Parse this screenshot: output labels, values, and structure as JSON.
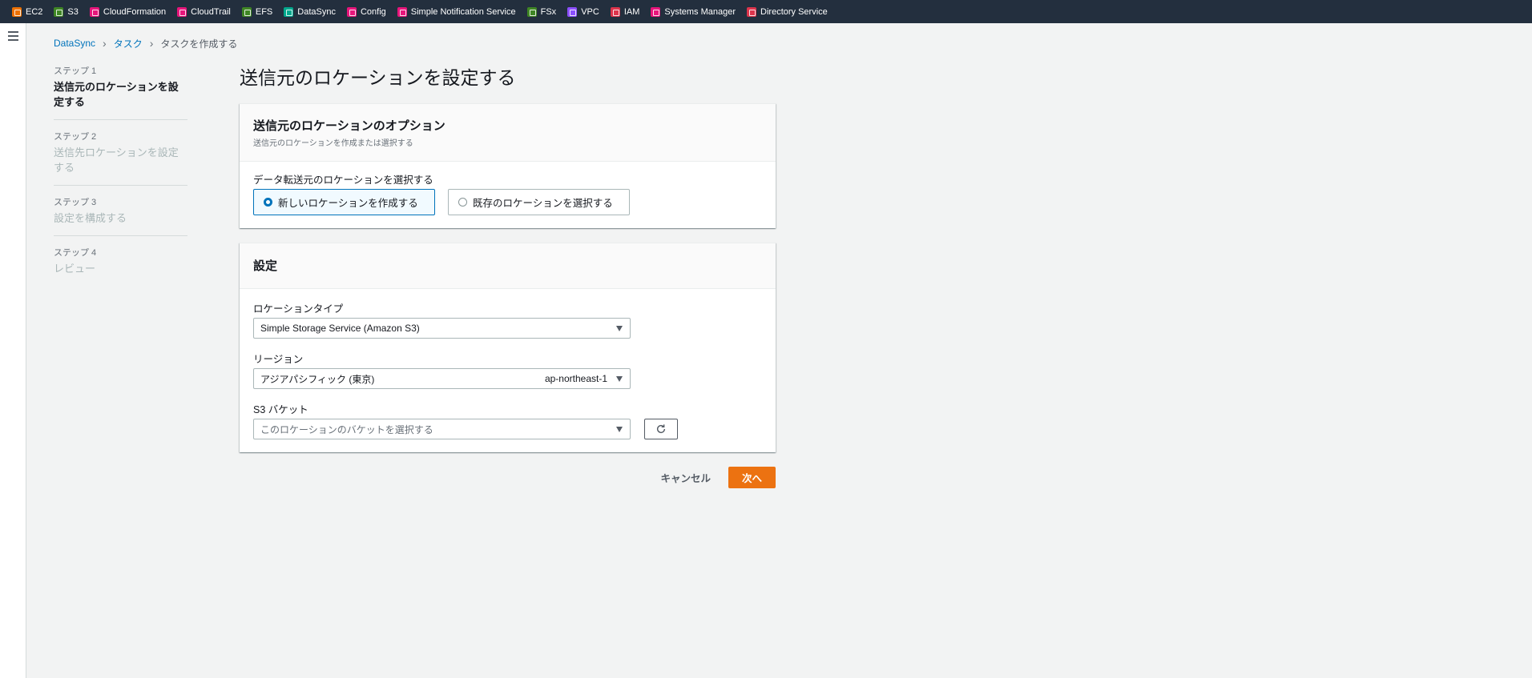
{
  "favorites": [
    {
      "label": "EC2",
      "color": "#ed7100"
    },
    {
      "label": "S3",
      "color": "#3f8624"
    },
    {
      "label": "CloudFormation",
      "color": "#e7157b"
    },
    {
      "label": "CloudTrail",
      "color": "#e7157b"
    },
    {
      "label": "EFS",
      "color": "#3f8624"
    },
    {
      "label": "DataSync",
      "color": "#01a88d"
    },
    {
      "label": "Config",
      "color": "#e7157b"
    },
    {
      "label": "Simple Notification Service",
      "color": "#e7157b"
    },
    {
      "label": "FSx",
      "color": "#3f8624"
    },
    {
      "label": "VPC",
      "color": "#8c4fff"
    },
    {
      "label": "IAM",
      "color": "#dd344c"
    },
    {
      "label": "Systems Manager",
      "color": "#e7157b"
    },
    {
      "label": "Directory Service",
      "color": "#dd344c"
    }
  ],
  "breadcrumb": {
    "items": [
      "DataSync",
      "タスク"
    ],
    "current": "タスクを作成する"
  },
  "steps": [
    {
      "num": "ステップ 1",
      "title": "送信元のロケーションを設定する",
      "active": true
    },
    {
      "num": "ステップ 2",
      "title": "送信先ロケーションを設定する",
      "active": false
    },
    {
      "num": "ステップ 3",
      "title": "設定を構成する",
      "active": false
    },
    {
      "num": "ステップ 4",
      "title": "レビュー",
      "active": false
    }
  ],
  "page_title": "送信元のロケーションを設定する",
  "options_panel": {
    "title": "送信元のロケーションのオプション",
    "description": "送信元のロケーションを作成または選択する",
    "field_label": "データ転送元のロケーションを選択する",
    "tiles": [
      {
        "label": "新しいロケーションを作成する",
        "selected": true
      },
      {
        "label": "既存のロケーションを選択する",
        "selected": false
      }
    ]
  },
  "settings_panel": {
    "title": "設定",
    "location_type": {
      "label": "ロケーションタイプ",
      "value": "Simple Storage Service (Amazon S3)"
    },
    "region": {
      "label": "リージョン",
      "value": "アジアパシフィック (東京)",
      "code": "ap-northeast-1"
    },
    "s3_bucket": {
      "label": "S3 バケット",
      "placeholder": "このロケーションのバケットを選択する"
    }
  },
  "actions": {
    "cancel": "キャンセル",
    "next": "次へ"
  },
  "colors": {
    "accent": "#0073bb",
    "primary_button": "#ec7211",
    "topbar": "#232f3e"
  }
}
